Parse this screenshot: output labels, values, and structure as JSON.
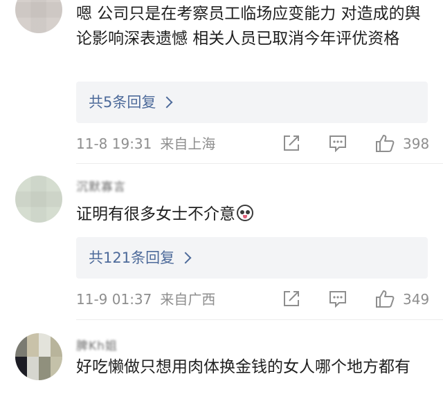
{
  "comments": [
    {
      "text": "嗯 公司只是在考察员工临场应变能力 对造成的舆论影响深表遗憾 相关人员已取消今年评优资格",
      "reply_link": "共5条回复",
      "date": "11-8 19:31",
      "location": "来自上海",
      "likes": "398"
    },
    {
      "username": "沉默寡言",
      "text": "证明有很多女士不介意",
      "emoji": "panda-face-emoji",
      "reply_link": "共121条回复",
      "date": "11-9 01:37",
      "location": "来自广西",
      "likes": "349"
    },
    {
      "username": "脾Kh姐",
      "text": "好吃懒做只想用肉体换金钱的女人哪个地方都有"
    }
  ],
  "icons": {
    "share": "share-icon",
    "comment": "comment-icon",
    "like": "thumbs-up-icon"
  },
  "colors": {
    "reply_link": "#4d6a9a",
    "meta_text": "#8e8e8e",
    "reply_bg": "#f3f4f6"
  }
}
